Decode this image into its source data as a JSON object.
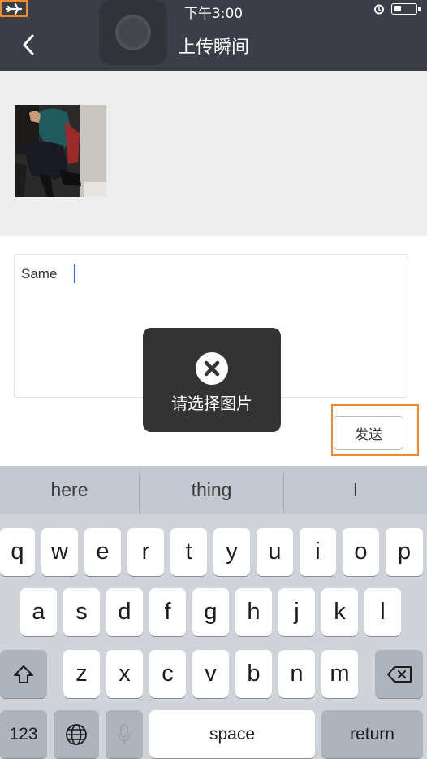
{
  "status_bar": {
    "time": "下午3:00",
    "battery_level": 0.35
  },
  "header": {
    "title": "上传瞬间"
  },
  "post": {
    "text_value": "Same"
  },
  "actions": {
    "send_label": "发送"
  },
  "toast": {
    "message": "请选择图片"
  },
  "keyboard": {
    "suggestions": [
      "here",
      "thing",
      "I"
    ],
    "row1": [
      "q",
      "w",
      "e",
      "r",
      "t",
      "y",
      "u",
      "i",
      "o",
      "p"
    ],
    "row2": [
      "a",
      "s",
      "d",
      "f",
      "g",
      "h",
      "j",
      "k",
      "l"
    ],
    "row3": [
      "z",
      "x",
      "c",
      "v",
      "b",
      "n",
      "m"
    ],
    "numbers_label": "123",
    "space_label": "space",
    "return_label": "return"
  },
  "colors": {
    "header_bg": "#3b3e47",
    "highlight": "#ef8a2b",
    "caret": "#3a64e8",
    "keyboard_bg": "#d0d3d9"
  }
}
